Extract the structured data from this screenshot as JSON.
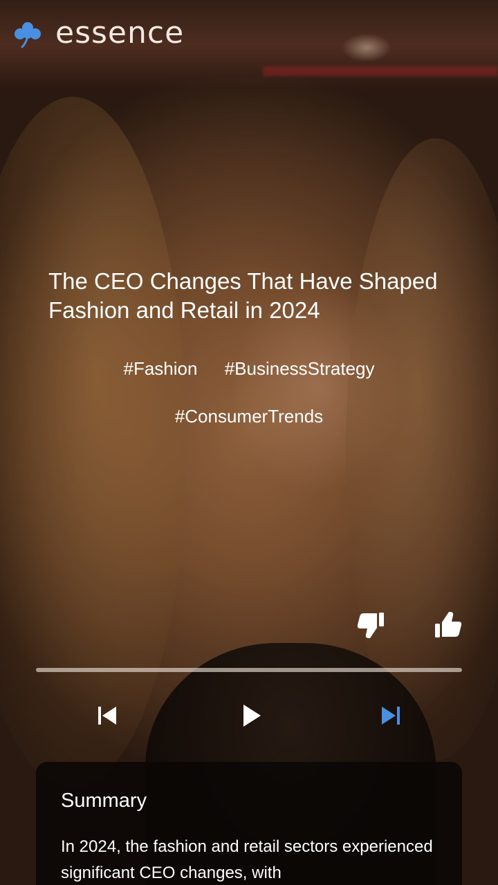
{
  "app": {
    "brand": "essence",
    "logo_icon": "clover-icon",
    "accent_color": "#4a90e2"
  },
  "article": {
    "title": "The CEO Changes That Have Shaped Fashion and Retail in 2024",
    "hashtags": [
      "#Fashion",
      "#BusinessStrategy",
      "#ConsumerTrends"
    ]
  },
  "reactions": {
    "dislike_icon": "thumbs-down-icon",
    "like_icon": "thumbs-up-icon"
  },
  "player": {
    "progress": 0,
    "prev_icon": "skip-previous-icon",
    "play_icon": "play-icon",
    "next_icon": "skip-next-icon"
  },
  "summary": {
    "heading": "Summary",
    "text": "In 2024, the fashion and retail sectors experienced significant CEO changes, with"
  }
}
